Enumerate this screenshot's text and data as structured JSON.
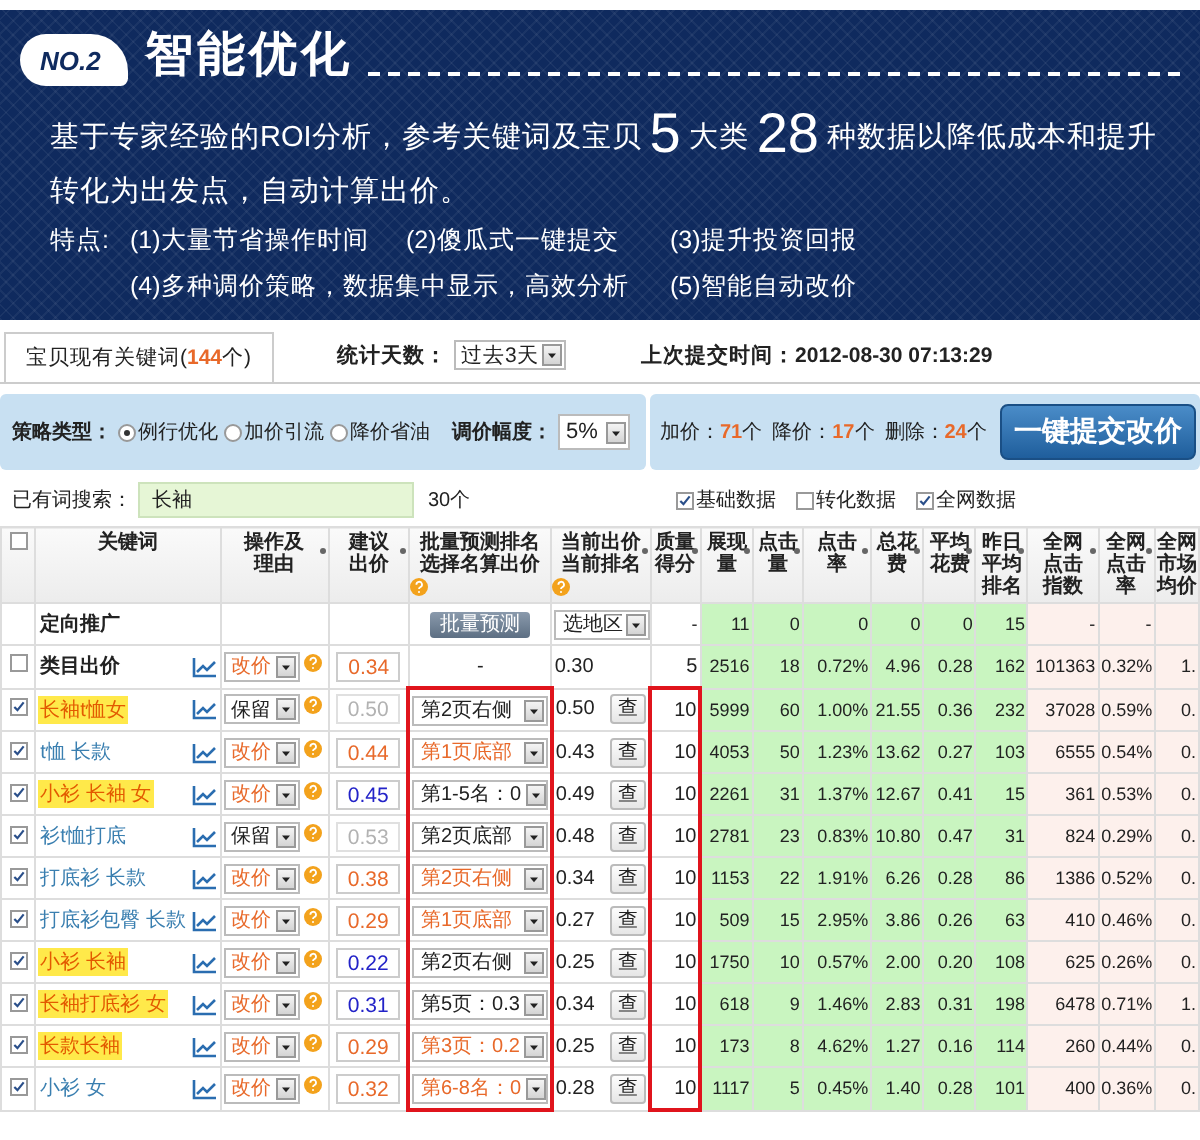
{
  "banner": {
    "badge": "NO.2",
    "title": "智能优化",
    "intro": [
      {
        "text": "基于专家经验的ROI分析，参考关键词及宝贝",
        "big": false
      },
      {
        "text": "5",
        "big": true
      },
      {
        "text": "大类",
        "big": false
      },
      {
        "text": "28",
        "big": true
      },
      {
        "text": "种数据以降低成本和提升转化为出发点，自动计算出价。",
        "big": false
      }
    ],
    "features_label": "特点:",
    "features": [
      "(1)大量节省操作时间",
      "(2)傻瓜式一键提交",
      "(3)提升投资回报",
      "(4)多种调价策略，数据集中显示，高效分析",
      "(5)智能自动改价"
    ]
  },
  "tabs": [
    {
      "label": "宝贝现有关键词(**144**个)",
      "selected": true
    }
  ],
  "stat_days": {
    "label": "统计天数：",
    "value": "过去3天"
  },
  "last_submit": "上次提交时间：2012-08-30 07:13:29",
  "strategy": {
    "label": "策略类型：",
    "options": [
      {
        "label": "例行优化",
        "selected": true
      },
      {
        "label": "加价引流",
        "selected": false
      },
      {
        "label": "降价省油",
        "selected": false
      }
    ],
    "range_label": "调价幅度：",
    "range_value": "5%"
  },
  "summary": {
    "items": [
      "加价：**71**个",
      "降价：**17**个",
      "删除：**24**个"
    ],
    "submit": "一键提交改价"
  },
  "search": {
    "label": "已有词搜索：",
    "value": "长袖",
    "count": "30个",
    "toggles": [
      {
        "label": "基础数据",
        "checked": true
      },
      {
        "label": "转化数据",
        "checked": false
      },
      {
        "label": "全网数据",
        "checked": true
      }
    ]
  },
  "table": {
    "header_checked": false,
    "columns": [
      {
        "label": "关键词",
        "sortable": false,
        "info": false
      },
      {
        "label": "操作及理由",
        "sortable": true,
        "info": false
      },
      {
        "label": "建议出价",
        "sortable": true,
        "info": false
      },
      {
        "label": "批量预测排名选择名算出价",
        "sortable": false,
        "info": true
      },
      {
        "label": "当前出价当前排名",
        "sortable": true,
        "info": true
      },
      {
        "label": "质量得分",
        "sortable": true,
        "info": false
      },
      {
        "label": "展现量",
        "sortable": true,
        "info": false
      },
      {
        "label": "点击量",
        "sortable": true,
        "info": false
      },
      {
        "label": "点击率",
        "sortable": true,
        "info": false
      },
      {
        "label": "总花费",
        "sortable": true,
        "info": false
      },
      {
        "label": "平均花费",
        "sortable": true,
        "info": false
      },
      {
        "label": "昨日平均排名",
        "sortable": true,
        "info": false
      },
      {
        "label": "全网点击指数",
        "sortable": true,
        "info": false
      },
      {
        "label": "全网点击率",
        "sortable": true,
        "info": false
      },
      {
        "label": "全网市场均价",
        "sortable": false,
        "info": false
      }
    ],
    "rows": [
      {
        "kind": "target",
        "keyword": "定向推广",
        "batch_button": "批量预测",
        "region": "选地区",
        "quality": "-",
        "stats": [
          "11",
          "0",
          "0",
          "0",
          "0",
          "15",
          "-",
          "-"
        ]
      },
      {
        "kind": "category",
        "checked": false,
        "keyword": "类目出价",
        "action": "改价",
        "action_highlighted": true,
        "bid": "0.34",
        "bid_disabled": false,
        "bid_lowered": false,
        "batch": "-",
        "current": "0.30",
        "quality": "5",
        "stats": [
          "2516",
          "18",
          "0.72%",
          "4.96",
          "0.28",
          "162",
          "101363",
          "0.32%",
          "1."
        ]
      },
      {
        "kind": "keyword",
        "checked": true,
        "highlighted": true,
        "keyword": "长袖t恤女",
        "action": "保留",
        "action_highlighted": false,
        "bid": "0.50",
        "bid_disabled": true,
        "bid_lowered": false,
        "rank": "第2页右侧",
        "rank_highlighted": false,
        "current": "0.50",
        "check": "查",
        "quality": "10",
        "stats": [
          "5999",
          "60",
          "1.00%",
          "21.55",
          "0.36",
          "232",
          "37028",
          "0.59%",
          "0."
        ]
      },
      {
        "kind": "keyword",
        "checked": true,
        "highlighted": false,
        "keyword": "t恤 长款",
        "action": "改价",
        "action_highlighted": true,
        "bid": "0.44",
        "bid_disabled": false,
        "bid_lowered": false,
        "rank": "第1页底部",
        "rank_highlighted": true,
        "current": "0.43",
        "check": "查",
        "quality": "10",
        "stats": [
          "4053",
          "50",
          "1.23%",
          "13.62",
          "0.27",
          "103",
          "6555",
          "0.54%",
          "0."
        ]
      },
      {
        "kind": "keyword",
        "checked": true,
        "highlighted": true,
        "keyword": "小衫 长袖 女",
        "action": "改价",
        "action_highlighted": true,
        "bid": "0.45",
        "bid_disabled": false,
        "bid_lowered": true,
        "rank": "第1-5名：0",
        "rank_highlighted": false,
        "current": "0.49",
        "check": "查",
        "quality": "10",
        "stats": [
          "2261",
          "31",
          "1.37%",
          "12.67",
          "0.41",
          "15",
          "361",
          "0.53%",
          "0."
        ]
      },
      {
        "kind": "keyword",
        "checked": true,
        "highlighted": false,
        "keyword": "衫t恤打底",
        "action": "保留",
        "action_highlighted": false,
        "bid": "0.53",
        "bid_disabled": true,
        "bid_lowered": false,
        "rank": "第2页底部",
        "rank_highlighted": false,
        "current": "0.48",
        "check": "查",
        "quality": "10",
        "stats": [
          "2781",
          "23",
          "0.83%",
          "10.80",
          "0.47",
          "31",
          "824",
          "0.29%",
          "0."
        ]
      },
      {
        "kind": "keyword",
        "checked": true,
        "highlighted": false,
        "keyword": "打底衫 长款",
        "action": "改价",
        "action_highlighted": true,
        "bid": "0.38",
        "bid_disabled": false,
        "bid_lowered": false,
        "rank": "第2页右侧",
        "rank_highlighted": true,
        "current": "0.34",
        "check": "查",
        "quality": "10",
        "stats": [
          "1153",
          "22",
          "1.91%",
          "6.26",
          "0.28",
          "86",
          "1386",
          "0.52%",
          "0."
        ]
      },
      {
        "kind": "keyword",
        "checked": true,
        "highlighted": false,
        "keyword": "打底衫包臀 长款",
        "action": "改价",
        "action_highlighted": true,
        "bid": "0.29",
        "bid_disabled": false,
        "bid_lowered": false,
        "rank": "第1页底部",
        "rank_highlighted": true,
        "current": "0.27",
        "check": "查",
        "quality": "10",
        "stats": [
          "509",
          "15",
          "2.95%",
          "3.86",
          "0.26",
          "63",
          "410",
          "0.46%",
          "0."
        ]
      },
      {
        "kind": "keyword",
        "checked": true,
        "highlighted": true,
        "keyword": "小衫 长袖",
        "action": "改价",
        "action_highlighted": true,
        "bid": "0.22",
        "bid_disabled": false,
        "bid_lowered": true,
        "rank": "第2页右侧",
        "rank_highlighted": false,
        "current": "0.25",
        "check": "查",
        "quality": "10",
        "stats": [
          "1750",
          "10",
          "0.57%",
          "2.00",
          "0.20",
          "108",
          "625",
          "0.26%",
          "0."
        ]
      },
      {
        "kind": "keyword",
        "checked": true,
        "highlighted": true,
        "keyword": "长袖打底衫 女",
        "action": "改价",
        "action_highlighted": true,
        "bid": "0.31",
        "bid_disabled": false,
        "bid_lowered": true,
        "rank": "第5页：0.3",
        "rank_highlighted": false,
        "current": "0.34",
        "check": "查",
        "quality": "10",
        "stats": [
          "618",
          "9",
          "1.46%",
          "2.83",
          "0.31",
          "198",
          "6478",
          "0.71%",
          "1."
        ]
      },
      {
        "kind": "keyword",
        "checked": true,
        "highlighted": true,
        "keyword": "长款长袖",
        "action": "改价",
        "action_highlighted": true,
        "bid": "0.29",
        "bid_disabled": false,
        "bid_lowered": false,
        "rank": "第3页：0.2",
        "rank_highlighted": true,
        "current": "0.25",
        "check": "查",
        "quality": "10",
        "stats": [
          "173",
          "8",
          "4.62%",
          "1.27",
          "0.16",
          "114",
          "260",
          "0.44%",
          "0."
        ]
      },
      {
        "kind": "keyword",
        "checked": true,
        "highlighted": false,
        "keyword": "小衫 女",
        "action": "改价",
        "action_highlighted": true,
        "bid": "0.32",
        "bid_disabled": false,
        "bid_lowered": false,
        "rank": "第6-8名：0",
        "rank_highlighted": true,
        "current": "0.28",
        "check": "查",
        "quality": "10",
        "stats": [
          "1117",
          "5",
          "0.45%",
          "1.40",
          "0.28",
          "101",
          "400",
          "0.36%",
          "0."
        ]
      }
    ]
  }
}
